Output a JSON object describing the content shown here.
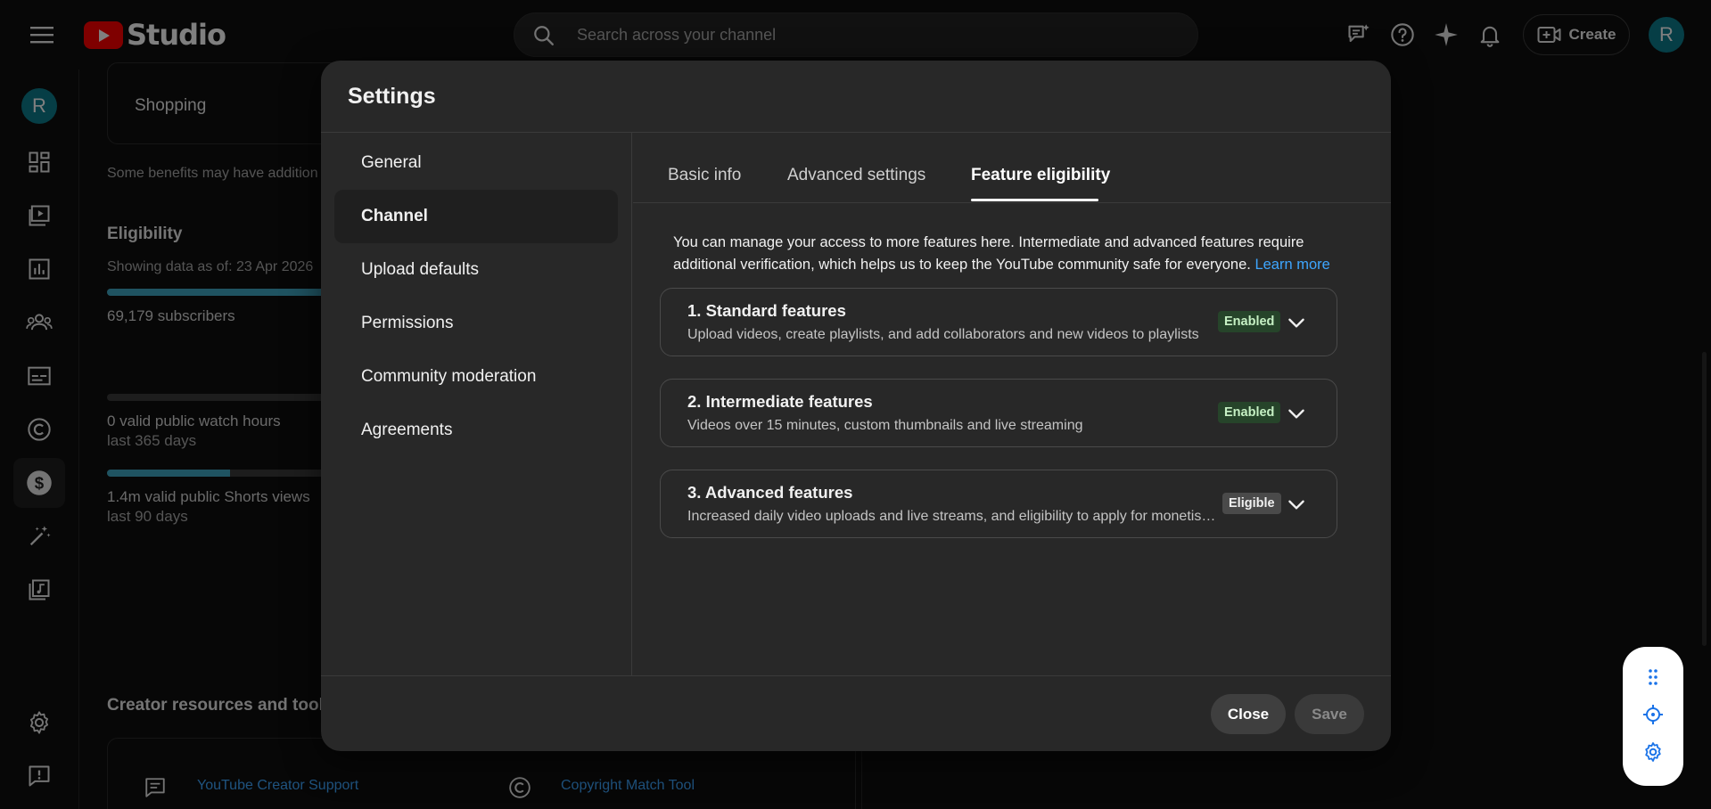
{
  "header": {
    "logo_text": "Studio",
    "search_placeholder": "Search across your channel",
    "create_label": "Create",
    "avatar_letter": "R"
  },
  "rail": {
    "avatar_letter": "R"
  },
  "background": {
    "shopping_label": "Shopping",
    "benefits_note": "Some benefits may have addition",
    "eligibility_heading": "Eligibility",
    "data_as_of": "Showing data as of: 23 Apr 2026",
    "subscribers": "69,179 subscribers",
    "watch_hours": "0 valid public watch hours",
    "watch_hours_period": "last 365 days",
    "shorts_views": "1.4m valid public Shorts views",
    "shorts_views_period": "last 90 days",
    "subscribers_progress": 0.95,
    "watch_hours_progress": 0.0,
    "shorts_progress": 0.53,
    "resources_heading": "Creator resources and tools",
    "creator_support": "YouTube Creator Support",
    "copyright_tool": "Copyright Match Tool"
  },
  "dialog": {
    "title": "Settings",
    "nav": [
      {
        "label": "General"
      },
      {
        "label": "Channel"
      },
      {
        "label": "Upload defaults"
      },
      {
        "label": "Permissions"
      },
      {
        "label": "Community moderation"
      },
      {
        "label": "Agreements"
      }
    ],
    "tabs": [
      {
        "label": "Basic info"
      },
      {
        "label": "Advanced settings"
      },
      {
        "label": "Feature eligibility"
      }
    ],
    "intro_text": "You can manage your access to more features here. Intermediate and advanced features require additional verification, which helps us to keep the YouTube community safe for everyone.",
    "learn_more": "Learn more",
    "features": [
      {
        "title": "1. Standard features",
        "desc": "Upload videos, create playlists, and add collaborators and new videos to playlists",
        "status": "Enabled"
      },
      {
        "title": "2. Intermediate features",
        "desc": "Videos over 15 minutes, custom thumbnails and live streaming",
        "status": "Enabled"
      },
      {
        "title": "3. Advanced features",
        "desc": "Increased daily video uploads and live streams, and eligibility to apply for monetisation",
        "status": "Eligible"
      }
    ],
    "close_label": "Close",
    "save_label": "Save"
  },
  "colors": {
    "accent_blue": "#3ea6ff",
    "enabled_badge_bg": "#26442a",
    "enabled_badge_text": "#c6f0c4",
    "avatar_bg": "#0c7c8c",
    "youtube_red": "#ff0000"
  }
}
